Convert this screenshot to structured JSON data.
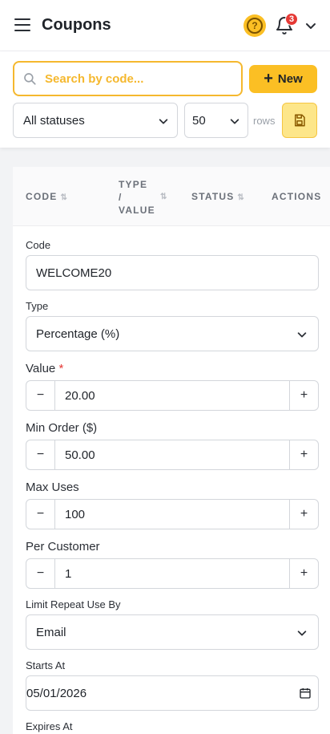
{
  "header": {
    "title": "Coupons",
    "notification_count": "3",
    "help_glyph": "?"
  },
  "toolbar": {
    "search_placeholder": "Search by code...",
    "new_label": "New",
    "status_filter": "All statuses",
    "rows_value": "50",
    "rows_label": "rows"
  },
  "table": {
    "headers": {
      "code": "Code",
      "type_value": "Type / Value",
      "type_word": "Type",
      "slash": "/",
      "value_word": "Value",
      "status": "Status",
      "actions": "Actions"
    }
  },
  "form": {
    "code_label": "Code",
    "code_value": "WELCOME20",
    "type_label": "Type",
    "type_value": "Percentage (%)",
    "value_label": "Value",
    "value_required": "*",
    "value_value": "20.00",
    "min_order_label": "Min Order ($)",
    "min_order_value": "50.00",
    "max_uses_label": "Max Uses",
    "max_uses_value": "100",
    "per_customer_label": "Per Customer",
    "per_customer_value": "1",
    "limit_repeat_label": "Limit Repeat Use By",
    "limit_repeat_value": "Email",
    "starts_at_label": "Starts At",
    "starts_at_value": "05/01/2026",
    "expires_at_label": "Expires At",
    "stepper_minus": "−",
    "stepper_plus": "+"
  },
  "colors": {
    "accent": "#fbbf24",
    "accent_border": "#f5b82e",
    "badge": "#e53935"
  },
  "icons": [
    "menu-icon",
    "help-icon",
    "bell-icon",
    "chevron-down-icon",
    "search-icon",
    "plus-icon",
    "save-icon",
    "sort-icon",
    "calendar-icon"
  ]
}
